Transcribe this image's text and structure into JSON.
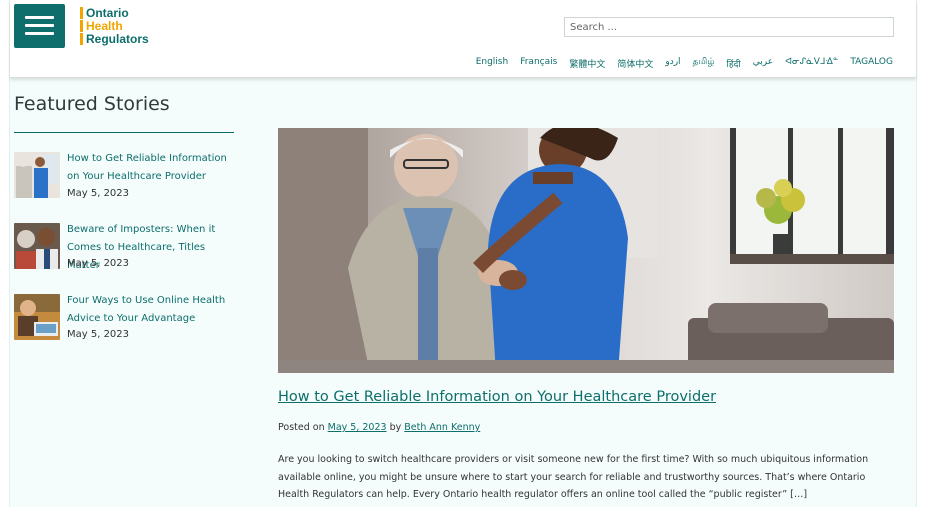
{
  "header": {
    "menu_icon": "hamburger-menu-icon",
    "logo": {
      "line1": "Ontario",
      "line2": "Health",
      "line3": "Regulators",
      "colors": [
        "#0d6e6b",
        "#f0a500",
        "#0d6e6b"
      ]
    },
    "search": {
      "placeholder": "Search ..."
    },
    "languages": [
      "English",
      "Français",
      "繁體中文",
      "简体中文",
      "اردو",
      "தமிழ்",
      "हिंदी",
      "عربي",
      "ᐊᓂᔑᓈᐯᒧᐎᓐ",
      "TAGALOG"
    ]
  },
  "sidebar": {
    "title": "Featured Stories",
    "stories": [
      {
        "title": "How to Get Reliable Information on Your Healthcare Provider",
        "date": "May 5, 2023"
      },
      {
        "title": "Beware of Imposters: When it Comes to Healthcare, Titles Matter",
        "date": "May 5, 2023"
      },
      {
        "title": "Four Ways to Use Online Health Advice to Your Advantage",
        "date": "May 5, 2023"
      }
    ]
  },
  "article": {
    "title": "How to Get Reliable Information on Your Healthcare Provider",
    "posted_on_label": "Posted on",
    "date": "May 5, 2023",
    "by_label": "by",
    "author": "Beth Ann Kenny",
    "excerpt": "Are you looking to switch healthcare providers or visit someone new for the first time? With so much ubiquitous information available online, you might be unsure where to start your search for reliable and trustworthy sources. That’s where Ontario Health Regulators can help. Every Ontario health regulator offers an online tool called the “public register” […]"
  },
  "colors": {
    "brand": "#0d6e6b",
    "accent": "#f0a500",
    "background": "#f4fdfc"
  }
}
